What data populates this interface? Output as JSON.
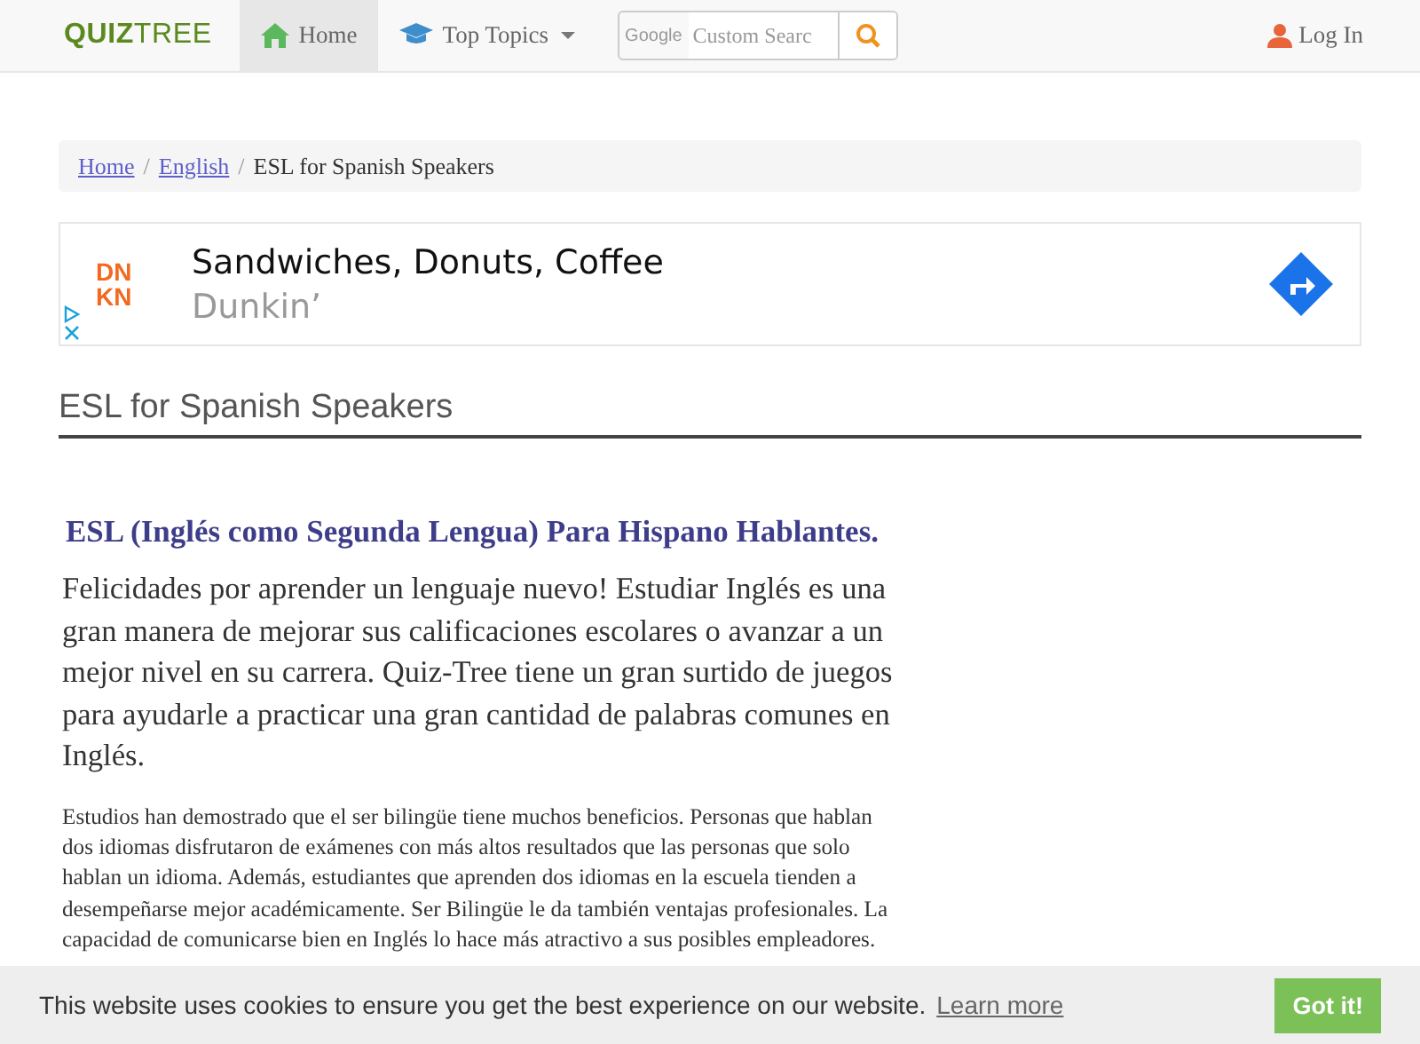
{
  "navbar": {
    "logo": "**QUIZ**TREE",
    "items": [
      {
        "label": "Home",
        "selected": true,
        "caret": false
      },
      {
        "label": "Top Topics",
        "selected": false,
        "caret": true
      }
    ],
    "search": {
      "brand": "Google",
      "placeholder": "Custom Searc"
    },
    "login": "Log In"
  },
  "breadcrumb_separator": "/",
  "breadcrumb": [
    {
      "label": "Home",
      "link": true
    },
    {
      "label": "English",
      "link": true
    },
    {
      "label": "ESL for Spanish Speakers",
      "link": false
    }
  ],
  "ad": {
    "logo_lines": [
      "DN",
      "KN"
    ],
    "headline": "Sandwiches, Donuts, Coffee",
    "advertiser": "Dunkin’"
  },
  "page_title": "ESL for Spanish Speakers",
  "article": {
    "heading": "ESL (Inglés como Segunda Lengua) Para Hispano Hablantes.",
    "lead": "Felicidades por aprender un lenguaje nuevo! Estudiar Inglés es una gran manera de mejorar sus calificaciones escolares o avanzar a un mejor nivel en su carrera. Quiz-Tree tiene un gran surtido de juegos para ayudarle a practicar una gran cantidad de palabras comunes en Inglés.",
    "body": "Estudios han demostrado que el ser bilingüe tiene muchos beneficios. Personas que hablan dos idiomas disfrutaron de exámenes con más altos resultados que las personas que solo hablan un idioma. Además, estudiantes que aprenden dos idiomas en la escuela tienden a desempeñarse mejor académicamente. Ser Bilingüe le da también ventajas profesionales. La capacidad de comunicarse bien en Inglés lo hace más atractivo a sus posibles empleadores."
  },
  "cookie_bar": {
    "message": "This website uses cookies to ensure you get the best experience on our website.",
    "link": "Learn more",
    "button": "Got it!"
  }
}
